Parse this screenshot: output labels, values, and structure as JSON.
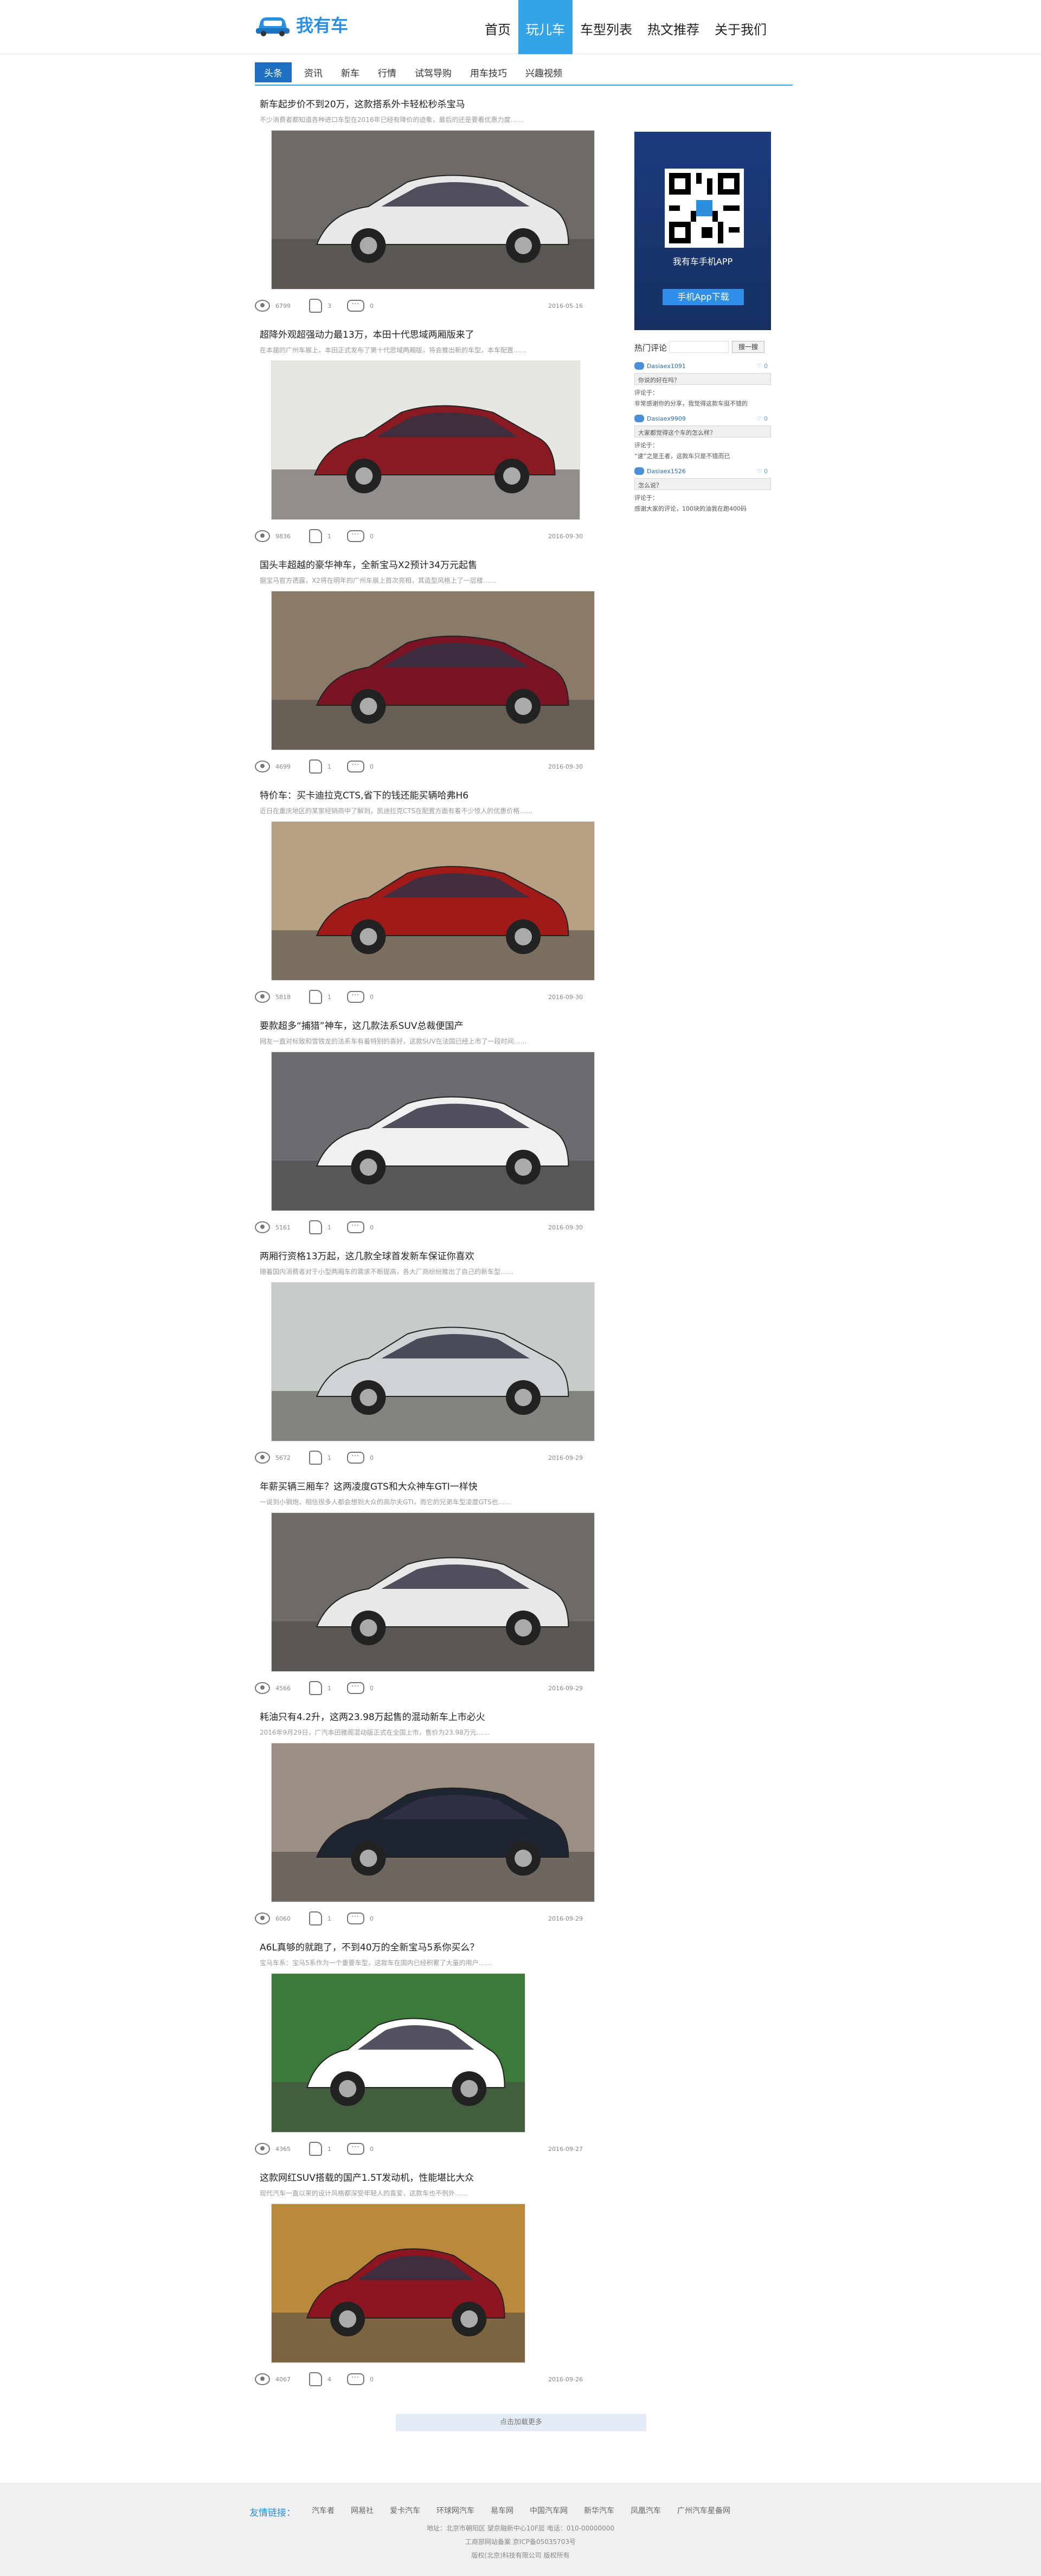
{
  "header": {
    "logo_text": "我有车",
    "nav": [
      "首页",
      "玩儿车",
      "车型列表",
      "热文推荐",
      "关于我们"
    ],
    "active_nav": 1
  },
  "subnav": {
    "items": [
      "头条",
      "资讯",
      "新车",
      "行情",
      "试驾导购",
      "用车技巧",
      "兴趣视频"
    ],
    "active": 0
  },
  "articles": [
    {
      "title": "新车起步价不到20万，这款搭系外卡轻松秒杀宝马 ",
      "summary": "不少消费者都知道各种进口车型在2016年已经有降价的迹象，最后的还是要看优惠力度……",
      "views": "6799",
      "likes": "3",
      "comments": "0",
      "date": "2016-05-16"
    },
    {
      "title": "超降外观超强动力最13万，本田十代思域两厢版来了",
      "summary": "在本届的广州车展上，本田正式发布了第十代思域两厢版，将会推出新的车型，本车配置……",
      "views": "9836",
      "likes": "1",
      "comments": "0",
      "date": "2016-09-30"
    },
    {
      "title": "国头丰超越的豪华神车，全新宝马X2预计34万元起售",
      "summary": "据宝马官方透露，X2将在明年的广州车展上首次亮相，其造型风格上了一层楼……",
      "views": "4699",
      "likes": "1",
      "comments": "0",
      "date": "2016-09-30"
    },
    {
      "title": "特价车：买卡迪拉克CTS,省下的钱还能买辆哈弗H6",
      "summary": "近日在重庆地区的某家经销商中了解到，凯迪拉克CTS在配置方面有着不少惊人的优惠价格……",
      "views": "5818",
      "likes": "1",
      "comments": "0",
      "date": "2016-09-30"
    },
    {
      "title": "要款超多“捕猎”神车，这几款法系SUV总裁便国产",
      "summary": "网友一直对标致和雪铁龙的法系车有着特别的喜好，这款SUV在法国已经上市了一段时间……",
      "views": "5161",
      "likes": "1",
      "comments": "0",
      "date": "2016-09-30"
    },
    {
      "title": "两厢行资格13万起，这几款全球首发新车保证你喜欢",
      "summary": "随着国内消费者对于小型两厢车的需求不断提高，各大厂商纷纷推出了自己的新车型……",
      "views": "5672",
      "likes": "1",
      "comments": "0",
      "date": "2016-09-29"
    },
    {
      "title": "年薪买辆三厢车？这两凌度GTS和大众神车GTI一样快",
      "summary": "一说到小钢炮，相信很多人都会想到大众的高尔夫GTI，而它的兄弟车型凌度GTS也……",
      "views": "4566",
      "likes": "1",
      "comments": "0",
      "date": "2016-09-29"
    },
    {
      "title": "耗油只有4.2升，这两23.98万起售的混动新车上市必火",
      "summary": "2016年9月29日，广汽本田雅阁混动版正式在全国上市，售价为23.98万元……",
      "views": "6060",
      "likes": "1",
      "comments": "0",
      "date": "2016-09-29"
    },
    {
      "title": "A6L真够的就跑了，不到40万的全新宝马5系你买么？",
      "summary": "宝马车系：宝马5系作为一个重要车型，这款车在国内已经积累了大量的用户……",
      "views": "4365",
      "likes": "1",
      "comments": "0",
      "date": "2016-09-27"
    },
    {
      "title": "这款网红SUV搭载的国产1.5T发动机，性能堪比大众",
      "summary": "现代汽车一直以来的设计风格都深受年轻人的喜爱，这款车也不例外……",
      "views": "4067",
      "likes": "4",
      "comments": "0",
      "date": "2016-09-26"
    }
  ],
  "loadmore": "点击加载更多",
  "sidebar": {
    "app_label": "我有车手机APP",
    "download_label": "手机App下载",
    "hot_title": "热门评论",
    "search_button": "搜一搜",
    "comments": [
      {
        "user": "Dasiaex1091",
        "likes": "0",
        "quote": "你说的好在吗？",
        "reply_label": "评论于：",
        "reply": "非常感谢你的分享，我觉得这款车挺不错的"
      },
      {
        "user": "Dasiaex9909",
        "likes": "0",
        "quote": "大家都觉得这个车的怎么样？",
        "reply_label": "评论于：",
        "reply": "“速”之是王者，这款车只是不错而已"
      },
      {
        "user": "Dasiaex1526",
        "likes": "0",
        "quote": "怎么说？",
        "reply_label": "评论于：",
        "reply": "感谢大家的评论，100块的油我在跑400码"
      }
    ]
  },
  "footer": {
    "links_title": "友情链接：",
    "links": [
      "汽车者",
      "网易社",
      "爱卡汽车",
      "环球网汽车",
      "易车网",
      "中国汽车网",
      "新华汽车",
      "凤凰汽车",
      "广州汽车星备网"
    ],
    "address": "地址：北京市朝阳区 望京融新中心10F层     电话：010-00000000",
    "icp": "工商部网站备案     京ICP备05035703号",
    "copyright": "版权(北京)科技有限公司  版权所有"
  }
}
